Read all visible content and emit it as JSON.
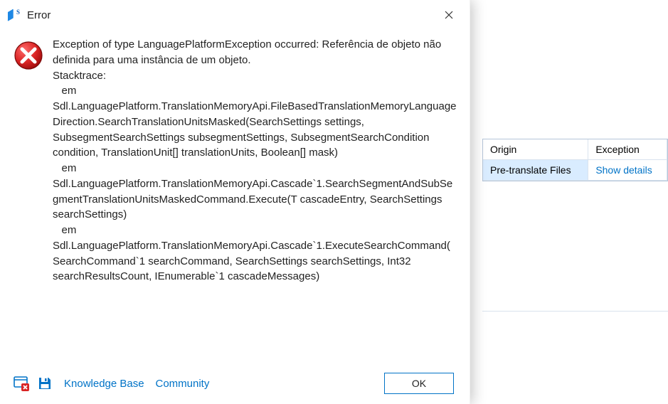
{
  "dialog": {
    "title": "Error",
    "message": "Exception of type LanguagePlatformException occurred: Referência de objeto não definida para uma instância de um objeto.\nStacktrace:\n   em Sdl.LanguagePlatform.TranslationMemoryApi.FileBasedTranslationMemoryLanguageDirection.SearchTranslationUnitsMasked(SearchSettings settings, SubsegmentSearchSettings subsegmentSettings, SubsegmentSearchCondition condition, TranslationUnit[] translationUnits, Boolean[] mask)\n   em Sdl.LanguagePlatform.TranslationMemoryApi.Cascade`1.SearchSegmentAndSubSegmentTranslationUnitsMaskedCommand.Execute(T cascadeEntry, SearchSettings searchSettings)\n   em Sdl.LanguagePlatform.TranslationMemoryApi.Cascade`1.ExecuteSearchCommand(SearchCommand`1 searchCommand, SearchSettings searchSettings, Int32 searchResultsCount, IEnumerable`1 cascadeMessages)",
    "links": {
      "kb": "Knowledge Base",
      "community": "Community"
    },
    "ok_label": "OK"
  },
  "bg_table": {
    "col_origin": "Origin",
    "col_exception": "Exception",
    "row_origin": "Pre-translate Files",
    "row_exception": "Show details"
  }
}
